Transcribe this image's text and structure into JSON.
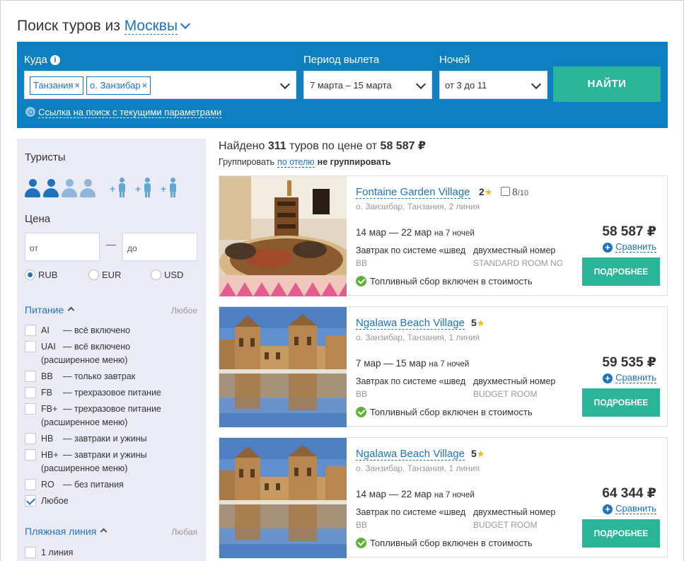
{
  "header": {
    "title": "Поиск туров из",
    "city": "Москвы"
  },
  "search": {
    "where_label": "Куда",
    "tags": [
      "Танзания",
      "о. Занзибар"
    ],
    "period_label": "Период вылета",
    "period_value": "7 марта – 15 марта",
    "nights_label": "Ночей",
    "nights_value": "от 3 до 11",
    "find_button": "НАЙТИ",
    "link_text": "Ссылка на поиск с текущими параметрами"
  },
  "filters": {
    "tourists_label": "Туристы",
    "adults_selected": 2,
    "adults_total": 4,
    "children_slots": 3,
    "price_label": "Цена",
    "price_from_placeholder": "от",
    "price_to_placeholder": "до",
    "price_dash": "—",
    "currencies": [
      "RUB",
      "EUR",
      "USD"
    ],
    "currency_selected": "RUB",
    "meal_label": "Питание",
    "meal_any": "Любое",
    "meals": [
      {
        "code": "AI",
        "desc": "— всё включено"
      },
      {
        "code": "UAI",
        "desc": "— всё включено",
        "extra": "(расширенное меню)"
      },
      {
        "code": "BB",
        "desc": "— только завтрак"
      },
      {
        "code": "FB",
        "desc": "— трехразовое питание"
      },
      {
        "code": "FB+",
        "desc": "— трехразовое питание",
        "extra": "(расширенное меню)"
      },
      {
        "code": "HB",
        "desc": "— завтраки и ужины"
      },
      {
        "code": "HB+",
        "desc": "— завтраки и ужины",
        "extra": "(расширенное меню)"
      },
      {
        "code": "RO",
        "desc": "— без питания"
      },
      {
        "code": "Любое",
        "desc": "",
        "checked": true
      }
    ],
    "beach_label": "Пляжная линия",
    "beach_any": "Любая",
    "beach_first": "1 линия"
  },
  "results": {
    "found_prefix": "Найдено",
    "count": "311",
    "found_middle": "туров по цене от",
    "min_price": "58 587 ₽",
    "group_label": "Группировать",
    "group_by_hotel": "по отелю",
    "no_group": "не группировать",
    "cards": [
      {
        "hotel": "Fontaine Garden Village",
        "stars": "2",
        "rating": "8",
        "rating_max": "/10",
        "location": "о. Занзибар, Танзания, 2 линия",
        "dates": "14 мар — 22 мар",
        "nights": "на 7 ночей",
        "meal": "Завтрак по системе «шведский стол»",
        "meal_code": "BB",
        "room": "двухместный номер",
        "room_code": "STANDARD ROOM NON REFUNDABLE",
        "fuel": "Топливный сбор включен в стоимость",
        "price": "58 587 ₽",
        "compare": "Сравнить",
        "more": "ПОДРОБНЕЕ"
      },
      {
        "hotel": "Ngalawa Beach Village",
        "stars": "5",
        "location": "о. Занзибар, Танзания, 1 линия",
        "dates": "7 мар — 15 мар",
        "nights": "на 7 ночей",
        "meal": "Завтрак по системе «шведский стол»",
        "meal_code": "BB",
        "room": "двухместный номер",
        "room_code": "BUDGET ROOM",
        "fuel": "Топливный сбор включен в стоимость",
        "price": "59 535 ₽",
        "compare": "Сравнить",
        "more": "ПОДРОБНЕЕ"
      },
      {
        "hotel": "Ngalawa Beach Village",
        "stars": "5",
        "location": "о. Занзибар, Танзания, 1 линия",
        "dates": "14 мар — 22 мар",
        "nights": "на 7 ночей",
        "meal": "Завтрак по системе «шведский стол»",
        "meal_code": "BB",
        "room": "двухместный номер",
        "room_code": "BUDGET ROOM",
        "fuel": "Топливный сбор включен в стоимость",
        "price": "64 344 ₽",
        "compare": "Сравнить",
        "more": "ПОДРОБНЕЕ"
      }
    ]
  },
  "colors": {
    "brand_blue": "#0e80c0",
    "link": "#1e73be",
    "accent_green": "#2bb598",
    "sidebar_bg": "#ebebf5",
    "star": "#f5b90f"
  }
}
